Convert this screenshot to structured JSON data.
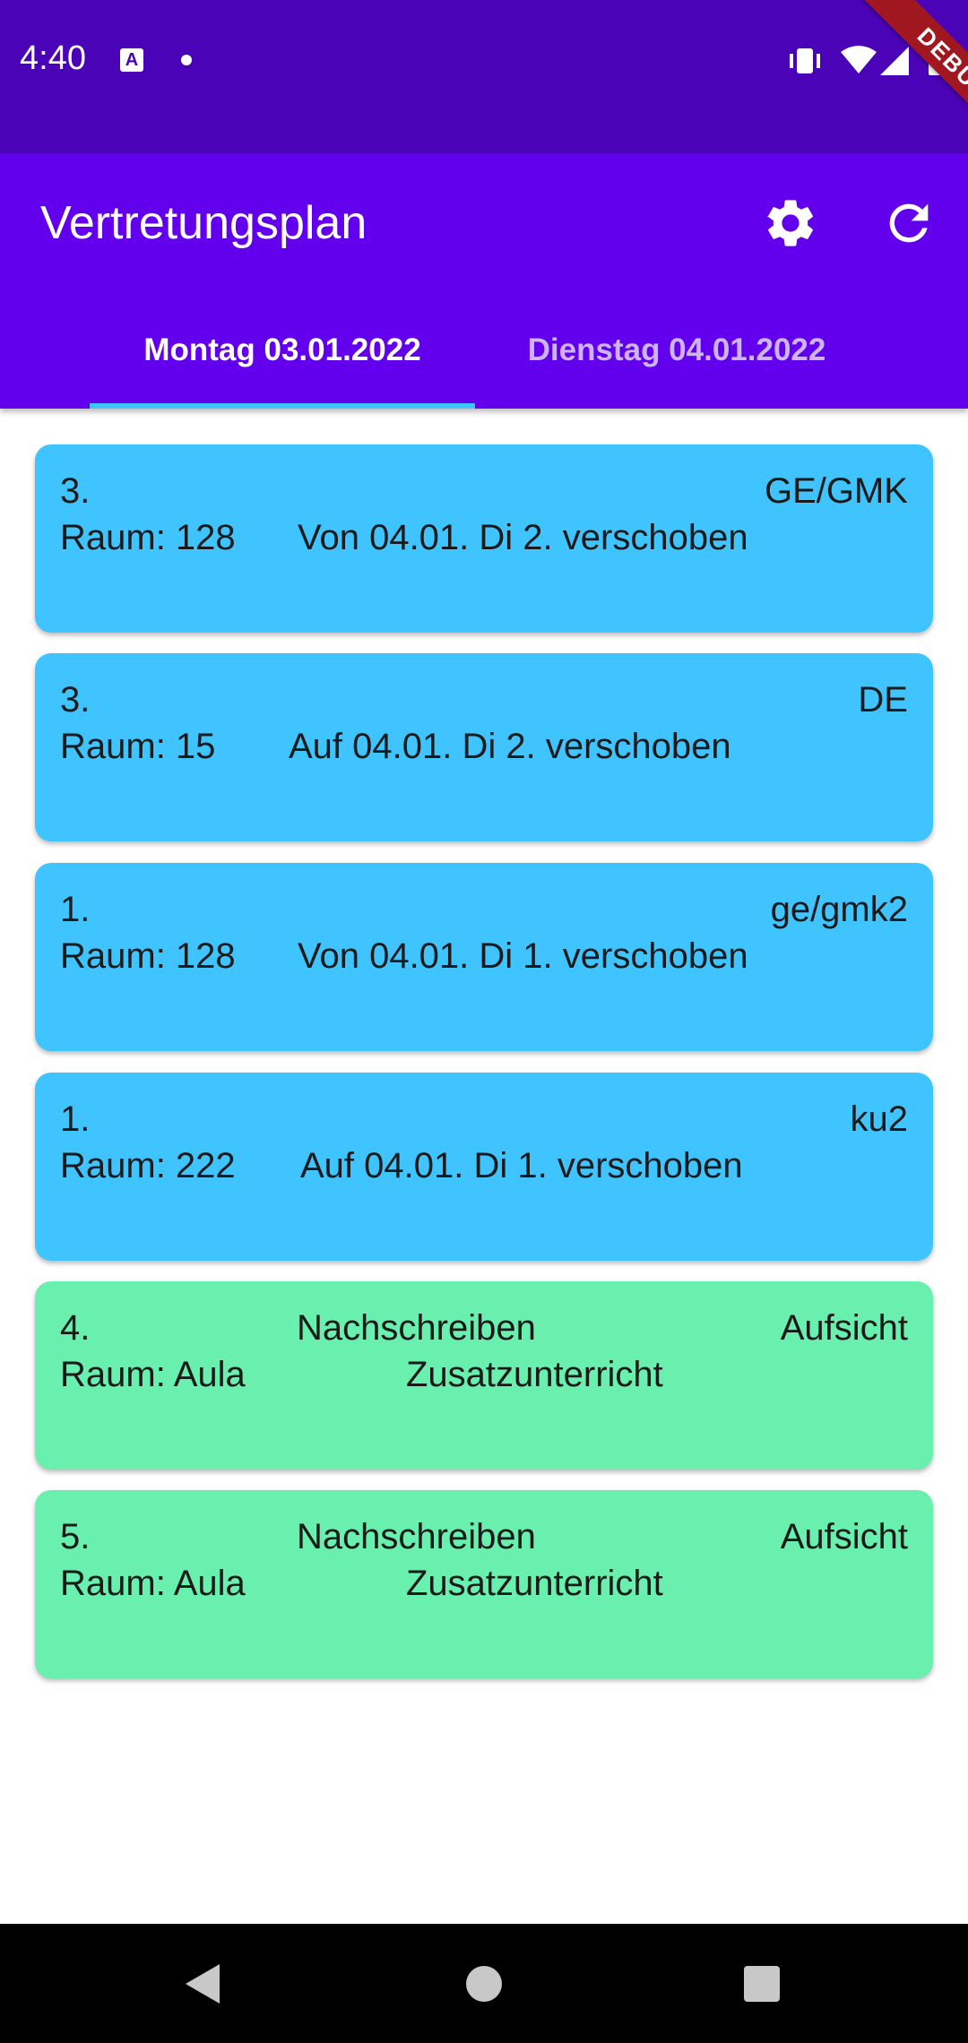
{
  "status_bar": {
    "time": "4:40",
    "a_icon": "A",
    "debug_label": "DEBUG"
  },
  "app_bar": {
    "title": "Vertretungsplan",
    "settings_icon": "gear-icon",
    "refresh_icon": "refresh-icon"
  },
  "tabs": [
    {
      "label": "Montag 03.01.2022",
      "selected": true
    },
    {
      "label": "Dienstag 04.01.2022",
      "selected": false
    }
  ],
  "colors": {
    "status_bar": "#4a03b6",
    "app_bar": "#6200ee",
    "tab_indicator": "#40c4ff",
    "card_blue": "#40c4ff",
    "card_green": "#69f0ae"
  },
  "cards": [
    {
      "period": "3.",
      "subject": "GE/GMK",
      "room": "Raum: 128",
      "info": "Von 04.01. Di 2. verschoben",
      "color": "blue"
    },
    {
      "period": "3.",
      "subject": "DE",
      "room": "Raum: 15",
      "info": "Auf 04.01. Di 2. verschoben",
      "color": "blue"
    },
    {
      "period": "1.",
      "subject": "ge/gmk2",
      "room": "Raum: 128",
      "info": "Von 04.01. Di 1. verschoben",
      "color": "blue"
    },
    {
      "period": "1.",
      "subject": "ku2",
      "room": "Raum: 222",
      "info": "Auf 04.01. Di 1. verschoben",
      "color": "blue"
    },
    {
      "period": "4.",
      "type": "Nachschreiben",
      "subject": "Aufsicht",
      "room": "Raum: Aula",
      "extra": "Zusatzunterricht",
      "color": "green"
    },
    {
      "period": "5.",
      "type": "Nachschreiben",
      "subject": "Aufsicht",
      "room": "Raum: Aula",
      "extra": "Zusatzunterricht",
      "color": "green"
    }
  ]
}
